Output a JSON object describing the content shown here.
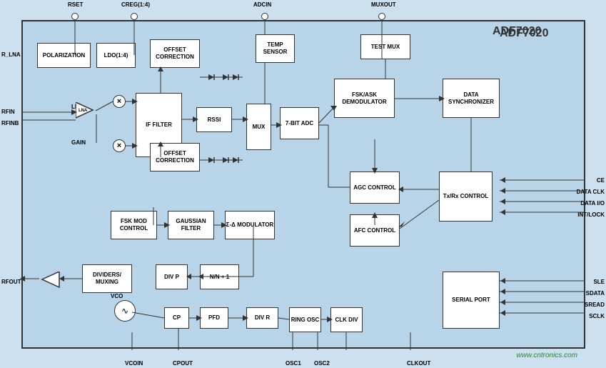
{
  "title": "ADF7020",
  "watermark": "www.cntronics.com",
  "blocks": {
    "polarization": "POLARIZATION",
    "ldo": "LDO(1:4)",
    "offset_correction_top": "OFFSET\nCORRECTION",
    "temp_sensor": "TEMP\nSENSOR",
    "test_mux": "TEST MUX",
    "if_filter": "IF FILTER",
    "rssi": "RSSI",
    "mux": "MUX",
    "adc": "7-BIT ADC",
    "fsk_ask": "FSK/ASK\nDEMODULATOR",
    "data_sync": "DATA\nSYNCHRONIZER",
    "offset_correction_bot": "OFFSET\nCORRECTION",
    "agc_control": "AGC\nCONTROL",
    "txrx_control": "Tx/Rx\nCONTROL",
    "afc_control": "AFC\nCONTROL",
    "fsk_mod": "FSK MOD\nCONTROL",
    "gaussian": "GAUSSIAN\nFILTER",
    "sigma_delta": "Σ-Δ\nMODULATOR",
    "dividers": "DIVIDERS/\nMUXING",
    "div_p": "DIV P",
    "n_n1": "N/N + 1",
    "cp": "CP",
    "pfd": "PFD",
    "div_r": "DIV R",
    "ring_osc": "RING\nOSC",
    "clk_div": "CLK\nDIV",
    "serial_port": "SERIAL\nPORT"
  },
  "pins": {
    "rset": "RSET",
    "creg": "CREG(1:4)",
    "adcin": "ADCIN",
    "muxout": "MUXOUT",
    "rlna": "R_LNA",
    "rfin": "RFIN",
    "rfinb": "RFINB",
    "rfout": "RFOUT",
    "vcoin": "VCOIN",
    "cpout": "CPOUT",
    "osc1": "OSC1",
    "osc2": "OSC2",
    "clkout": "CLKOUT",
    "ce": "CE",
    "data_clk": "DATA CLK",
    "data_io": "DATA I/O",
    "int_lock": "INT/LOCK",
    "sle": "SLE",
    "sdata": "SDATA",
    "sread": "SREAD",
    "sclk": "SCLK",
    "lna": "LNA",
    "gain": "GAIN",
    "vco": "VCO"
  }
}
